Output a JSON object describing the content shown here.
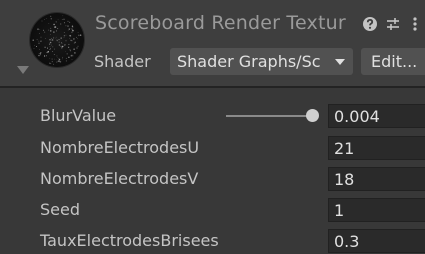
{
  "header": {
    "title": "Scoreboard Render Textur",
    "shader_label": "Shader",
    "shader_value": "Shader Graphs/Sc",
    "edit_label": "Edit...",
    "icons": [
      "help-icon",
      "presets-icon",
      "more-options-icon"
    ]
  },
  "properties": [
    {
      "label": "BlurValue",
      "value": "0.004",
      "control": "slider",
      "slider_fraction": 1.0
    },
    {
      "label": "NombreElectrodesU",
      "value": "21",
      "control": "field"
    },
    {
      "label": "NombreElectrodesV",
      "value": "18",
      "control": "field"
    },
    {
      "label": "Seed",
      "value": "1",
      "control": "field"
    },
    {
      "label": "TauxElectrodesBrisees",
      "value": "0.3",
      "control": "field"
    }
  ],
  "colors": {
    "background": "#383838",
    "header_background": "#3e3e3e",
    "field_background": "#2a2a2a",
    "button_background": "#515151",
    "text": "#c4c4c4",
    "title_text": "#9a9a9a"
  }
}
